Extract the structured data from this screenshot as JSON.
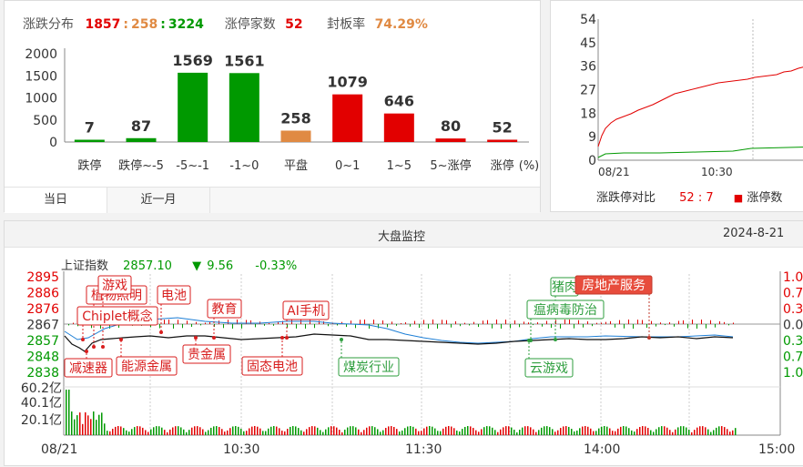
{
  "distribution": {
    "title": "涨跌分布",
    "up": "1857",
    "flat": "258",
    "down": "3224",
    "sep": ":",
    "limit_up_label": "涨停家数",
    "limit_up_count": "52",
    "seal_rate_label": "封板率",
    "seal_rate": "74.29%",
    "unit_label": "(%)",
    "tabs": [
      "当日",
      "近一月"
    ]
  },
  "ratio": {
    "label": "涨跌停对比",
    "up": "52",
    "sep": ":",
    "down": "7",
    "legend": "涨停数",
    "x_labels": [
      "08/21",
      "10:30"
    ],
    "y_ticks": [
      "54",
      "45",
      "36",
      "27",
      "18",
      "9",
      "0"
    ]
  },
  "monitor": {
    "title": "大盘监控",
    "date": "2024-8-21",
    "index_name": "上证指数",
    "index_value": "2857.10",
    "change_arrow": "▼",
    "change": "9.56",
    "change_pct": "-0.33%",
    "price_ticks": [
      "2895",
      "2886",
      "2876",
      "2867",
      "2857",
      "2848",
      "2838"
    ],
    "pct_ticks": [
      "1.0",
      "0.7",
      "0.3",
      "0.0",
      "0.3",
      "0.7",
      "1.0"
    ],
    "vol_ticks": [
      "60.2亿",
      "40.1亿",
      "20.1亿"
    ],
    "time_labels": [
      "08/21",
      "10:30",
      "11:30",
      "14:00",
      "15:00"
    ],
    "tags_red": [
      "游戏",
      "植物照明",
      "电池",
      "Chiplet概念",
      "教育",
      "AI手机",
      "减速器",
      "能源金属",
      "贵金属",
      "固态电池"
    ],
    "tags_green": [
      "煤炭行业",
      "云游戏",
      "瘟病毒防治",
      "猪肉"
    ],
    "tag_highlight": "房地产服务"
  },
  "colors": {
    "up": "#e20000",
    "down": "#009900",
    "flat": "#e08a43"
  },
  "chart_data": [
    {
      "type": "bar",
      "categories": [
        "跌停",
        "跌停~-5",
        "-5~-1",
        "-1~0",
        "平盘",
        "0~1",
        "1~5",
        "5~涨停",
        "涨停"
      ],
      "values": [
        7,
        87,
        1569,
        1561,
        258,
        1079,
        646,
        80,
        52
      ],
      "value_labels": [
        "7",
        "87",
        "1569",
        "1561",
        "258",
        "1079",
        "646",
        "80",
        "52"
      ],
      "bar_colors": [
        "#009900",
        "#009900",
        "#009900",
        "#009900",
        "#e08a43",
        "#e20000",
        "#e20000",
        "#e20000",
        "#e20000"
      ],
      "y_ticks": [
        "2000",
        "1500",
        "1000",
        "500",
        "0"
      ],
      "ylim": [
        0,
        2000
      ]
    }
  ]
}
